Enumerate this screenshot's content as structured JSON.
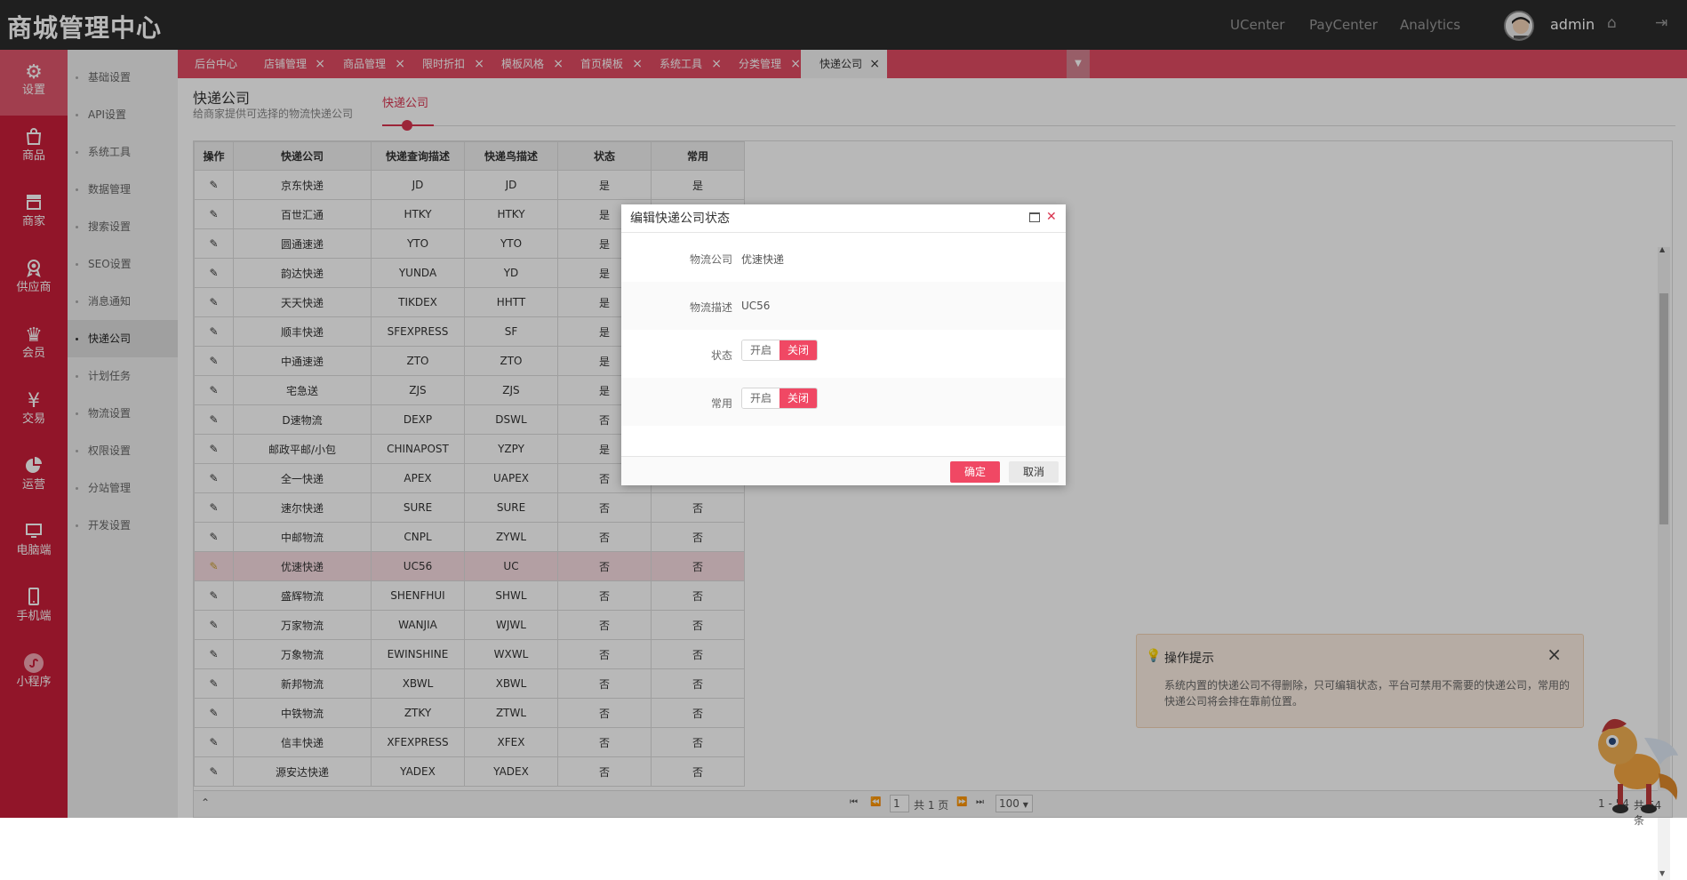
{
  "header": {
    "brand": "商城管理中心",
    "nav": [
      "UCenter",
      "PayCenter",
      "Analytics"
    ],
    "user": "admin"
  },
  "sidebar": {
    "items": [
      {
        "icon": "gear-icon",
        "label": "设置"
      },
      {
        "icon": "bag-icon",
        "label": "商品"
      },
      {
        "icon": "store-icon",
        "label": "商家"
      },
      {
        "icon": "award-icon",
        "label": "供应商"
      },
      {
        "icon": "crown-icon",
        "label": "会员"
      },
      {
        "icon": "yen-icon",
        "label": "交易"
      },
      {
        "icon": "pie-icon",
        "label": "运营"
      },
      {
        "icon": "monitor-icon",
        "label": "电脑端"
      },
      {
        "icon": "phone-icon",
        "label": "手机端"
      },
      {
        "icon": "miniapp-icon",
        "label": "小程序"
      }
    ],
    "active_index": 0
  },
  "submenu": {
    "items": [
      "基础设置",
      "API设置",
      "系统工具",
      "数据管理",
      "搜索设置",
      "SEO设置",
      "消息通知",
      "快递公司",
      "计划任务",
      "物流设置",
      "权限设置",
      "分站管理",
      "开发设置"
    ],
    "active_index": 7
  },
  "tabs": [
    "后台中心",
    "店铺管理",
    "商品管理",
    "限时折扣",
    "模板风格",
    "首页模板",
    "系统工具",
    "分类管理",
    "快递公司"
  ],
  "page": {
    "title": "快递公司",
    "subtitle": "给商家提供可选择的物流快递公司",
    "tab": "快递公司"
  },
  "table": {
    "headers": [
      "操作",
      "快递公司",
      "快递查询描述",
      "快递鸟描述",
      "状态",
      "常用"
    ],
    "rows": [
      [
        "京东快递",
        "JD",
        "JD",
        "是",
        "是"
      ],
      [
        "百世汇通",
        "HTKY",
        "HTKY",
        "是",
        ""
      ],
      [
        "圆通速递",
        "YTO",
        "YTO",
        "是",
        ""
      ],
      [
        "韵达快递",
        "YUNDA",
        "YD",
        "是",
        ""
      ],
      [
        "天天快递",
        "TIKDEX",
        "HHTT",
        "是",
        ""
      ],
      [
        "顺丰快递",
        "SFEXPRESS",
        "SF",
        "是",
        ""
      ],
      [
        "中通速递",
        "ZTO",
        "ZTO",
        "是",
        ""
      ],
      [
        "宅急送",
        "ZJS",
        "ZJS",
        "是",
        ""
      ],
      [
        "D速物流",
        "DEXP",
        "DSWL",
        "否",
        ""
      ],
      [
        "邮政平邮/小包",
        "CHINAPOST",
        "YZPY",
        "是",
        ""
      ],
      [
        "全一快递",
        "APEX",
        "UAPEX",
        "否",
        ""
      ],
      [
        "速尔快递",
        "SURE",
        "SURE",
        "否",
        "否"
      ],
      [
        "中邮物流",
        "CNPL",
        "ZYWL",
        "否",
        "否"
      ],
      [
        "优速快递",
        "UC56",
        "UC",
        "否",
        "否"
      ],
      [
        "盛辉物流",
        "SHENFHUI",
        "SHWL",
        "否",
        "否"
      ],
      [
        "万家物流",
        "WANJIA",
        "WJWL",
        "否",
        "否"
      ],
      [
        "万象物流",
        "EWINSHINE",
        "WXWL",
        "否",
        "否"
      ],
      [
        "新邦物流",
        "XBWL",
        "XBWL",
        "否",
        "否"
      ],
      [
        "中铁物流",
        "ZTKY",
        "ZTWL",
        "否",
        "否"
      ],
      [
        "信丰快递",
        "XFEXPRESS",
        "XFEX",
        "否",
        "否"
      ],
      [
        "源安达快递",
        "YADEX",
        "YADEX",
        "否",
        "否"
      ]
    ],
    "highlight_row": 13
  },
  "pager": {
    "page": "1",
    "total_pages": "共 1 页",
    "page_size": "100",
    "range": "1 - 54",
    "total": "共 54 条"
  },
  "dialog": {
    "title": "编辑快递公司状态",
    "company_label": "物流公司",
    "company_value": "优速快递",
    "desc_label": "物流描述",
    "desc_value": "UC56",
    "status_label": "状态",
    "common_label": "常用",
    "on_label": "开启",
    "off_label": "关闭",
    "ok": "确定",
    "cancel": "取消"
  },
  "tip": {
    "title": "操作提示",
    "body": "系统内置的快递公司不得删除，只可编辑状态，平台可禁用不需要的快递公司，常用的快递公司将会排在靠前位置。"
  },
  "colors": {
    "brand_red": "#c91e39",
    "tab_red": "#e14b63",
    "accent": "#f04864",
    "topbar": "#2b2b2b"
  }
}
